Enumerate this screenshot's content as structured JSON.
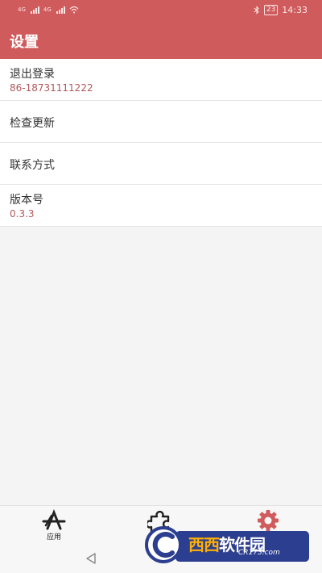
{
  "status_bar": {
    "network1": "4G",
    "network2": "4G",
    "battery": "23",
    "time": "14:33"
  },
  "header": {
    "title": "设置"
  },
  "settings": {
    "logout": {
      "label": "退出登录",
      "value": "86-18731111222"
    },
    "check_update": {
      "label": "检查更新"
    },
    "contact": {
      "label": "联系方式"
    },
    "version": {
      "label": "版本号",
      "value": "0.3.3"
    }
  },
  "tabs": [
    {
      "label": "应用",
      "icon": "app-store-icon"
    },
    {
      "label": "",
      "icon": "puzzle-icon"
    },
    {
      "label": "",
      "icon": "gear-icon",
      "active_color": "#d05b5c"
    }
  ],
  "watermark": {
    "main_a": "西西",
    "main_b": "软件园",
    "sub": "CR173.com"
  },
  "colors": {
    "accent": "#d05b5c",
    "value_text": "#b0585a"
  }
}
